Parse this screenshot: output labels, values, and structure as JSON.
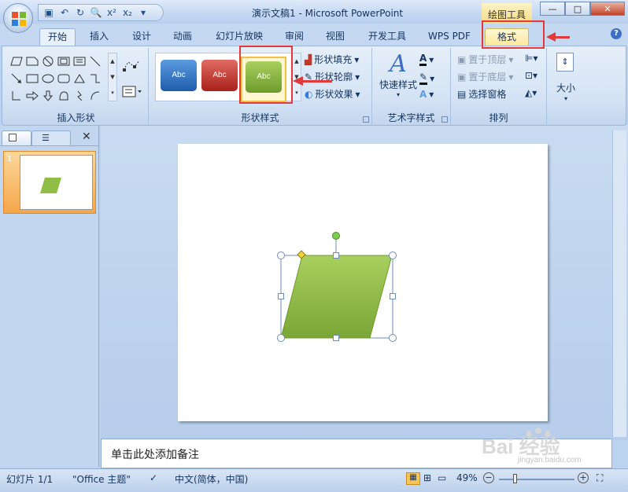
{
  "window": {
    "title": "演示文稿1 - Microsoft PowerPoint",
    "context_tab": "绘图工具",
    "minimize": "—",
    "maximize": "□",
    "close": "✕"
  },
  "qat": {
    "save": "save-icon",
    "undo": "undo-icon",
    "redo": "redo-icon",
    "preview": "print-preview-icon",
    "superscript": "x²",
    "subscript": "x₂",
    "more": "▾"
  },
  "tabs": [
    "开始",
    "插入",
    "设计",
    "动画",
    "幻灯片放映",
    "审阅",
    "视图",
    "开发工具",
    "WPS PDF",
    "格式"
  ],
  "active_tab": "格式",
  "groups": {
    "insert_shapes": {
      "label": "插入形状"
    },
    "shape_styles": {
      "label": "形状样式",
      "swatches": [
        "Abc",
        "Abc",
        "Abc"
      ],
      "swatch_colors": [
        "#2e6fc4",
        "#c8302b",
        "#7fac3a"
      ],
      "fill": "形状填充",
      "outline": "形状轮廓",
      "effects": "形状效果"
    },
    "wordart": {
      "label": "艺术字样式",
      "quick": "快速样式"
    },
    "arrange": {
      "label": "排列",
      "bring_front": "置于顶层",
      "send_back": "置于底层",
      "selection_pane": "选择窗格"
    },
    "size": {
      "label": "大小"
    }
  },
  "slides_pane": {
    "slide_number": "1"
  },
  "notes": {
    "placeholder": "单击此处添加备注"
  },
  "status": {
    "slide": "幻灯片 1/1",
    "theme": "\"Office 主题\"",
    "language": "中文(简体，中国)",
    "zoom": "49%"
  },
  "watermark": {
    "brand": "Bai  经验",
    "url": "jingyan.baidu.com"
  },
  "colors": {
    "accent_red": "#e23a3a",
    "shape_green": "#8fbd45"
  }
}
